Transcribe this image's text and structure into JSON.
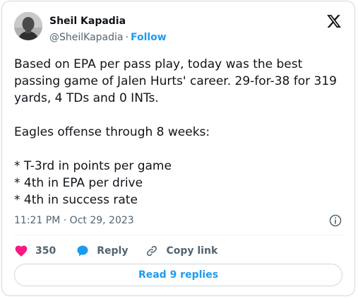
{
  "author": {
    "name": "Sheil Kapadia",
    "handle": "@SheilKapadia",
    "separator": "·",
    "follow_label": "Follow"
  },
  "tweet": {
    "text": "Based on EPA per pass play, today was the best passing game of Jalen Hurts' career. 29-for-38 for 319 yards, 4 TDs and 0 INTs.\n\nEagles offense through 8 weeks:\n\n* T-3rd in points per game\n* 4th in EPA per drive\n* 4th in success rate",
    "timestamp": "11:21 PM · Oct 29, 2023"
  },
  "actions": {
    "likes_count": "350",
    "reply_label": "Reply",
    "copy_link_label": "Copy link"
  },
  "read_replies_label": "Read 9 replies",
  "icons": {
    "logo": "x-logo-icon",
    "info": "info-icon",
    "like": "heart-icon",
    "reply": "reply-bubble-icon",
    "copy": "link-icon"
  },
  "colors": {
    "accent": "#1d9bf0",
    "like": "#f91880",
    "text": "#0f1419",
    "secondary": "#536471",
    "border": "#cfd9de"
  }
}
